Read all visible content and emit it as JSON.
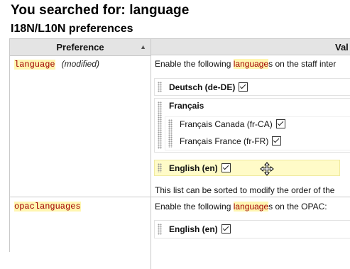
{
  "page": {
    "title": "You searched for: language",
    "section": "I18N/L10N preferences"
  },
  "table": {
    "col_preference": "Preference",
    "col_value": "Val",
    "rows": [
      {
        "name": "language",
        "status": "(modified)",
        "desc_before": "Enable the following ",
        "desc_kw": "language",
        "desc_after": "s on the staff inter",
        "languages": [
          "Deutsch (de-DE)",
          "Français",
          "English (en)"
        ],
        "sublanguages": [
          "Français Canada (fr-CA)",
          "Français France (fr-FR)"
        ],
        "note": "This list can be sorted to modify the order of the"
      },
      {
        "name": "opaclanguages",
        "desc_before": "Enable the following ",
        "desc_kw": "language",
        "desc_after": "s on the OPAC:",
        "languages": [
          "English (en)"
        ]
      }
    ]
  },
  "icons": {
    "sort": "sort-ascending-icon",
    "cursor": "move-cursor-icon",
    "drag": "drag-handle-icon",
    "check": "checkbox-checked-icon"
  },
  "colors": {
    "highlight": "#fff6b0",
    "varname": "#a00000",
    "header_bg": "#e4e4e4"
  }
}
